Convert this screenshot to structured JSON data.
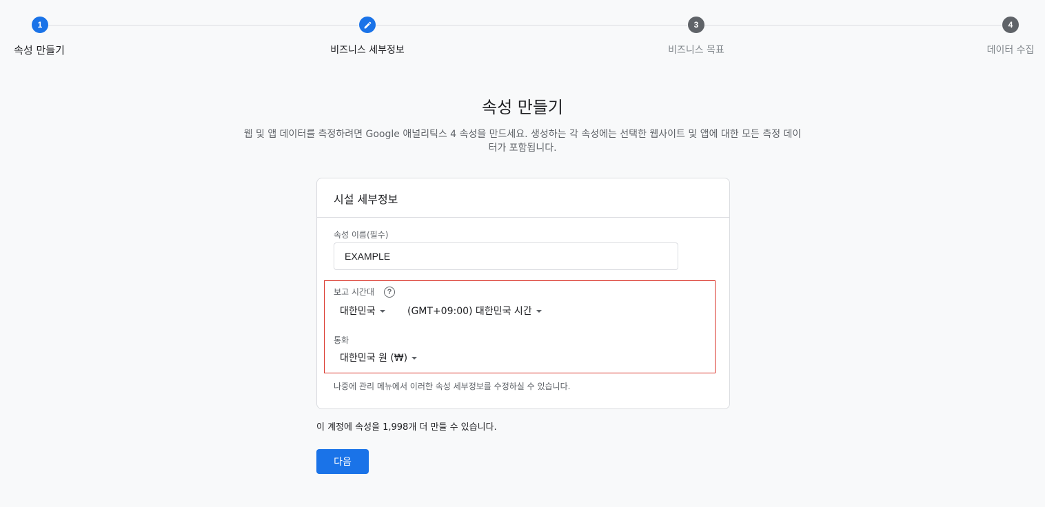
{
  "stepper": {
    "steps": [
      {
        "number": "1",
        "label": "속성 만들기",
        "state": "done"
      },
      {
        "number": "",
        "label": "비즈니스 세부정보",
        "state": "current",
        "icon": "pencil-icon"
      },
      {
        "number": "3",
        "label": "비즈니스 목표",
        "state": "pending"
      },
      {
        "number": "4",
        "label": "데이터 수집",
        "state": "pending"
      }
    ]
  },
  "header": {
    "title": "속성 만들기",
    "description": "웹 및 앱 데이터를 측정하려면 Google 애널리틱스 4 속성을 만드세요. 생성하는 각 속성에는 선택한 웹사이트 및 앱에 대한 모든 측정 데이터가 포함됩니다."
  },
  "card": {
    "title": "시설 세부정보",
    "property_name": {
      "label": "속성 이름(필수)",
      "value": "EXAMPLE"
    },
    "timezone": {
      "label": "보고 시간대",
      "help_icon": "?",
      "country": "대한민국",
      "zone": "(GMT+09:00) 대한민국 시간"
    },
    "currency": {
      "label": "통화",
      "value": "대한민국 원 (₩)"
    },
    "note": "나중에 관리 메뉴에서 이러한 속성 세부정보를 수정하실 수 있습니다."
  },
  "footer": {
    "remaining_text": "이 계정에 속성을 1,998개 더 만들 수 있습니다.",
    "next_label": "다음"
  },
  "colors": {
    "accent": "#1a73e8",
    "inactive": "#5f6368",
    "highlight": "#d93025"
  }
}
